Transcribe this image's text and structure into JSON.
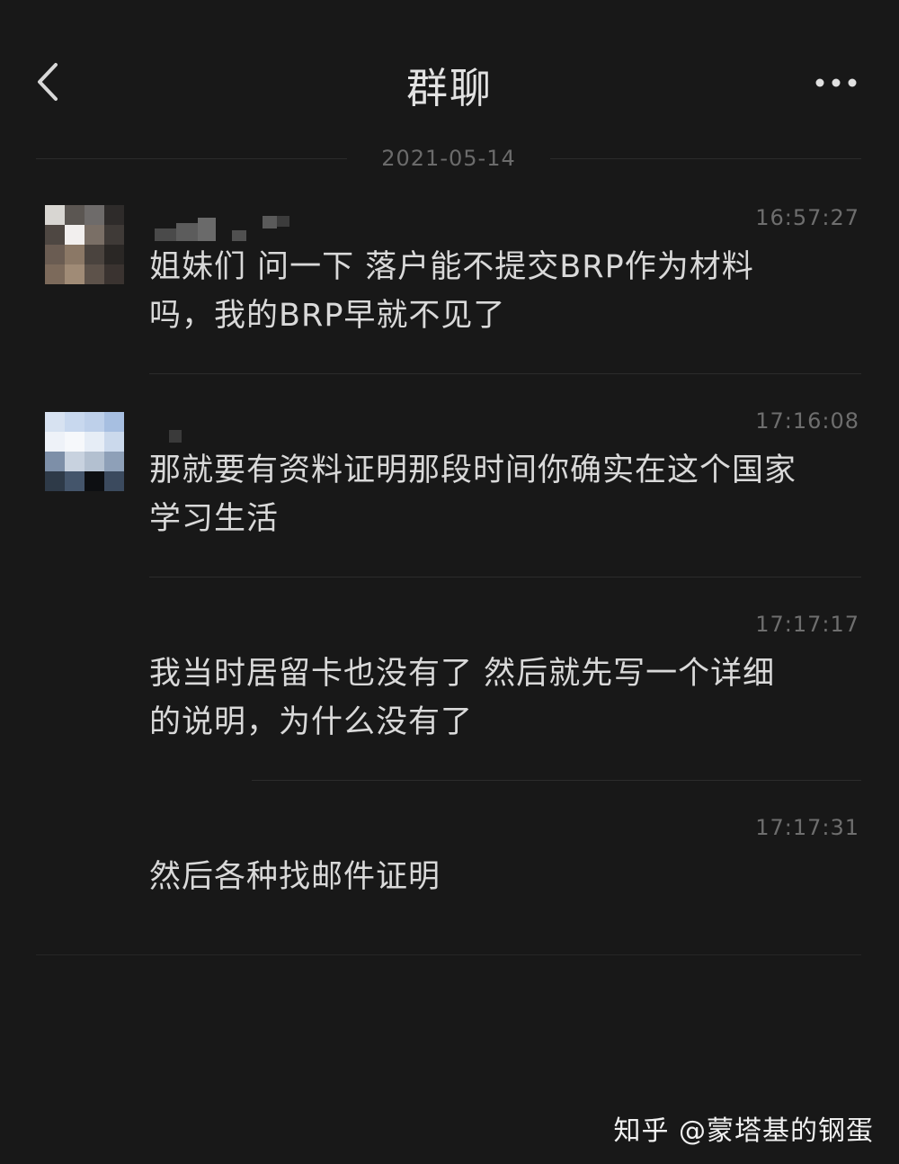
{
  "header": {
    "title": "群聊",
    "back_icon": "chevron-left-icon",
    "more_icon": "more-horizontal-icon"
  },
  "date_divider": "2021-05-14",
  "messages": [
    {
      "time": "16:57:27",
      "text": "姐妹们 问一下 落户能不提交BRP作为材料吗，我的BRP早就不见了",
      "line1": "姐妹们 问一下 落户能不提交BRP作为材料",
      "line2": "吗，我的BRP早就不见了"
    },
    {
      "time": "17:16:08",
      "line1": "那就要有资料证明那段时间你确实在这个国家",
      "line2": "学习生活"
    },
    {
      "time": "17:17:17",
      "line1": "我当时居留卡也没有了 然后就先写一个详细",
      "line2": "的说明，为什么没有了"
    },
    {
      "time": "17:17:31",
      "line1": "然后各种找邮件证明",
      "line2": ""
    }
  ],
  "watermark": "知乎 @蒙塔基的钢蛋",
  "colors": {
    "background": "#181818",
    "text": "#d9d9d9",
    "muted": "#6e6e6e"
  }
}
